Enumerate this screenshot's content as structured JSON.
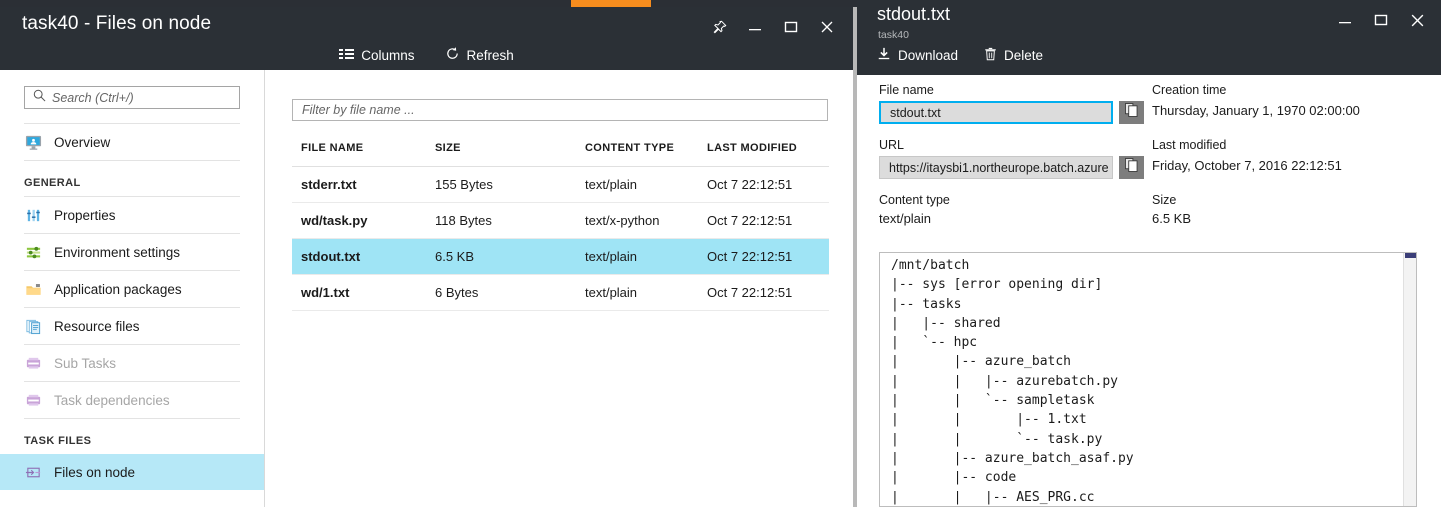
{
  "window": {
    "accent_color": "#f78d1e",
    "header_bg": "#2b3036",
    "selection_color": "#9fe4f5"
  },
  "blade": {
    "title": "task40 - Files on node",
    "controls": [
      {
        "name": "pin-icon",
        "label": "Pin"
      },
      {
        "name": "minimize-icon",
        "label": "Minimize"
      },
      {
        "name": "maximize-icon",
        "label": "Maximize"
      },
      {
        "name": "close-icon",
        "label": "Close"
      }
    ],
    "toolbar": [
      {
        "icon": "columns-icon",
        "label": "Columns"
      },
      {
        "icon": "refresh-icon",
        "label": "Refresh"
      }
    ]
  },
  "sidebar": {
    "search": {
      "placeholder": "Search (Ctrl+/)",
      "value": "",
      "icon": "search-icon"
    },
    "items": [
      {
        "label": "Overview",
        "icon": "overview-monitor-icon",
        "disabled": false,
        "selected": false
      },
      {
        "label": "Properties",
        "icon": "properties-sliders-icon",
        "disabled": false,
        "selected": false
      },
      {
        "label": "Environment settings",
        "icon": "environment-settings-icon",
        "disabled": false,
        "selected": false
      },
      {
        "label": "Application packages",
        "icon": "application-packages-folder-icon",
        "disabled": false,
        "selected": false
      },
      {
        "label": "Resource files",
        "icon": "resource-files-icon",
        "disabled": false,
        "selected": false
      },
      {
        "label": "Sub Tasks",
        "icon": "sub-tasks-icon",
        "disabled": true,
        "selected": false
      },
      {
        "label": "Task dependencies",
        "icon": "task-dependencies-icon",
        "disabled": true,
        "selected": false
      },
      {
        "label": "Files on node",
        "icon": "files-on-node-icon",
        "disabled": false,
        "selected": true
      }
    ],
    "groups": {
      "general": "GENERAL",
      "task_files": "TASK FILES"
    }
  },
  "files_pane": {
    "filter": {
      "placeholder": "Filter by file name ...",
      "value": ""
    },
    "columns": [
      "FILE NAME",
      "SIZE",
      "CONTENT TYPE",
      "LAST MODIFIED"
    ],
    "rows": [
      {
        "name": "stderr.txt",
        "size": "155 Bytes",
        "content_type": "text/plain",
        "last_modified": "Oct 7 22:12:51",
        "selected": false
      },
      {
        "name": "wd/task.py",
        "size": "118 Bytes",
        "content_type": "text/x-python",
        "last_modified": "Oct 7 22:12:51",
        "selected": false
      },
      {
        "name": "stdout.txt",
        "size": "6.5 KB",
        "content_type": "text/plain",
        "last_modified": "Oct 7 22:12:51",
        "selected": true
      },
      {
        "name": "wd/1.txt",
        "size": "6 Bytes",
        "content_type": "text/plain",
        "last_modified": "Oct 7 22:12:51",
        "selected": false
      }
    ]
  },
  "detail_blade": {
    "title": "stdout.txt",
    "subtitle": "task40",
    "toolbar": [
      {
        "icon": "download-icon",
        "label": "Download"
      },
      {
        "icon": "trash-icon",
        "label": "Delete"
      }
    ],
    "controls": [
      {
        "name": "minimize-icon",
        "label": "Minimize"
      },
      {
        "name": "maximize-icon",
        "label": "Maximize"
      },
      {
        "name": "close-icon",
        "label": "Close"
      }
    ],
    "properties": {
      "file_name_label": "File name",
      "file_name_value": "stdout.txt",
      "creation_time_label": "Creation time",
      "creation_time_value": "Thursday, January 1, 1970 02:00:00",
      "url_label": "URL",
      "url_value": "https://itaysbi1.northeurope.batch.azure",
      "last_modified_label": "Last modified",
      "last_modified_value": "Friday, October 7, 2016 22:12:51",
      "content_type_label": "Content type",
      "content_type_value": "text/plain",
      "size_label": "Size",
      "size_value": "6.5 KB",
      "copy_button_label": "Copy to clipboard"
    },
    "file_content": "/mnt/batch\n|-- sys [error opening dir]\n|-- tasks\n|   |-- shared\n|   `-- hpc\n|       |-- azure_batch\n|       |   |-- azurebatch.py\n|       |   `-- sampletask\n|       |       |-- 1.txt\n|       |       `-- task.py\n|       |-- azure_batch_asaf.py\n|       |-- code\n|       |   |-- AES_PRG.cc"
  }
}
